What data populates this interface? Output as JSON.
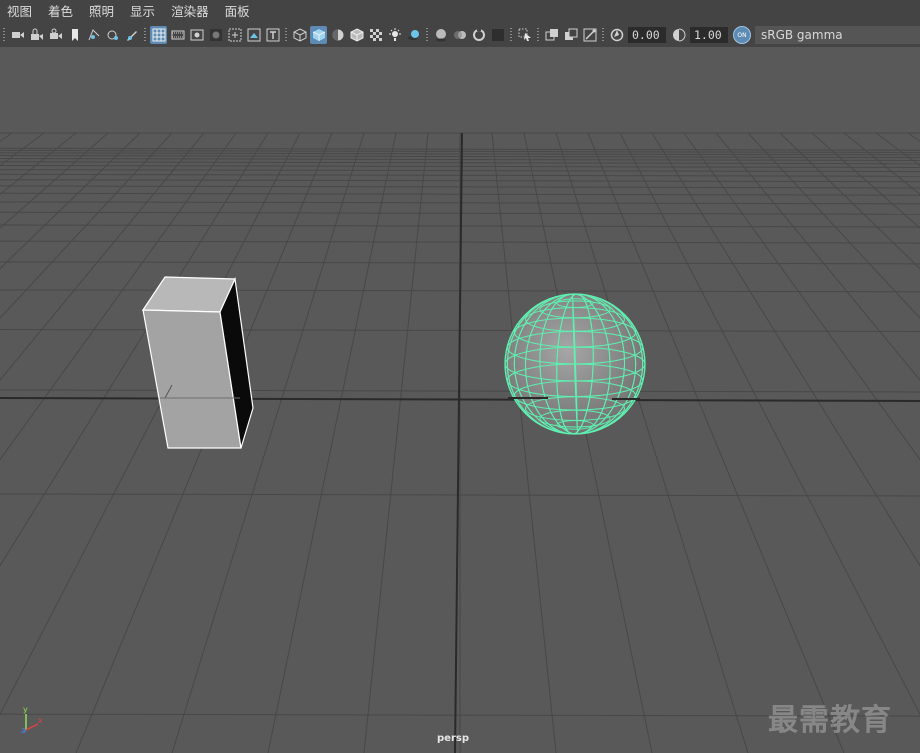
{
  "menu": [
    "视图",
    "着色",
    "照明",
    "显示",
    "渲染器",
    "面板"
  ],
  "toolbar": {
    "exposure_value": "0.00",
    "gamma_value": "1.00",
    "color_mgmt_label": "ON",
    "color_space": "sRGB gamma"
  },
  "viewport": {
    "camera": "persp",
    "axis": {
      "x": "x",
      "y": "y",
      "z": "z"
    },
    "selection_color": "#5ef0b0"
  },
  "watermark": "最需教育"
}
